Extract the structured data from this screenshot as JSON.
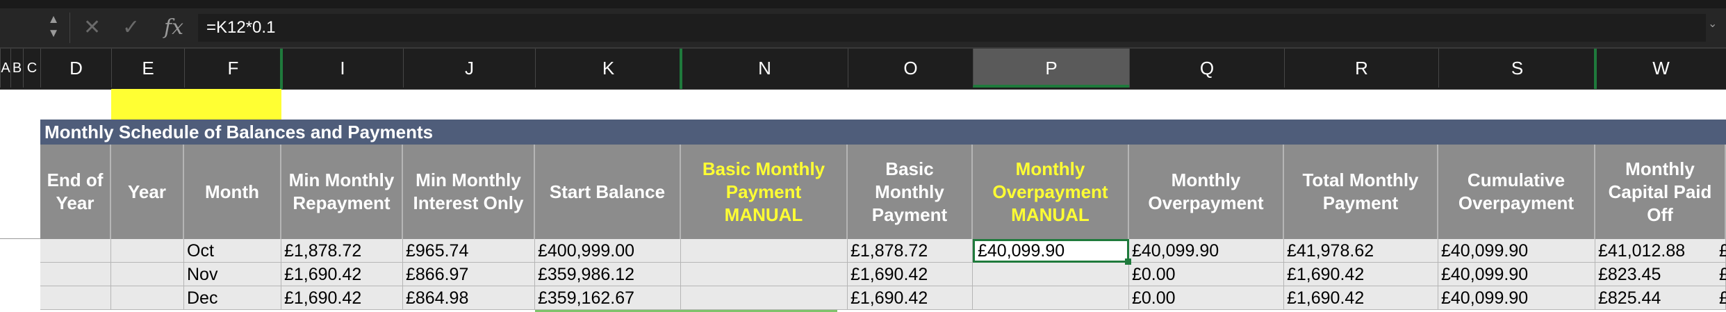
{
  "formula_bar": {
    "formula": "=K12*0.1",
    "fx_label": "fx",
    "cancel_glyph": "✕",
    "confirm_glyph": "✓"
  },
  "columns": [
    "A",
    "B",
    "C",
    "D",
    "E",
    "F",
    "I",
    "J",
    "K",
    "N",
    "O",
    "P",
    "Q",
    "R",
    "S",
    "W"
  ],
  "selected_column": "P",
  "table": {
    "title": "Monthly Schedule of Balances and Payments",
    "headers": [
      "End of\nYear",
      "Year",
      "Month",
      "Min Monthly\nRepayment",
      "Min Monthly\nInterest Only",
      "Start Balance",
      "Basic Monthly\nPayment\nMANUAL",
      "Basic\nMonthly\nPayment",
      "Monthly\nOverpayment\nMANUAL",
      "Monthly\nOverpayment",
      "Total Monthly\nPayment",
      "Cumulative\nOverpayment",
      "Monthly\nCapital Paid\nOff"
    ],
    "manual_headers": [
      6,
      8
    ],
    "rows": [
      [
        "",
        "",
        "Oct",
        "£1,878.72",
        "£965.74",
        "£400,999.00",
        "",
        "£1,878.72",
        "£40,099.90",
        "£40,099.90",
        "£41,978.62",
        "£40,099.90",
        "£41,012.88"
      ],
      [
        "",
        "",
        "Nov",
        "£1,690.42",
        "£866.97",
        "£359,986.12",
        "",
        "£1,690.42",
        "",
        "£0.00",
        "£1,690.42",
        "£40,099.90",
        "£823.45"
      ],
      [
        "",
        "",
        "Dec",
        "£1,690.42",
        "£864.98",
        "£359,162.67",
        "",
        "£1,690.42",
        "",
        "£0.00",
        "£1,690.42",
        "£40,099.90",
        "£825.44"
      ]
    ],
    "selected_cell": "P12",
    "overflow_glyph": "£"
  },
  "colors": {
    "accent_green": "#1f7a3c",
    "title_band": "#4f5d7a",
    "header_fill": "#8c8c8c",
    "manual_text": "#ffff33",
    "highlight_yellow": "#ffff33"
  }
}
